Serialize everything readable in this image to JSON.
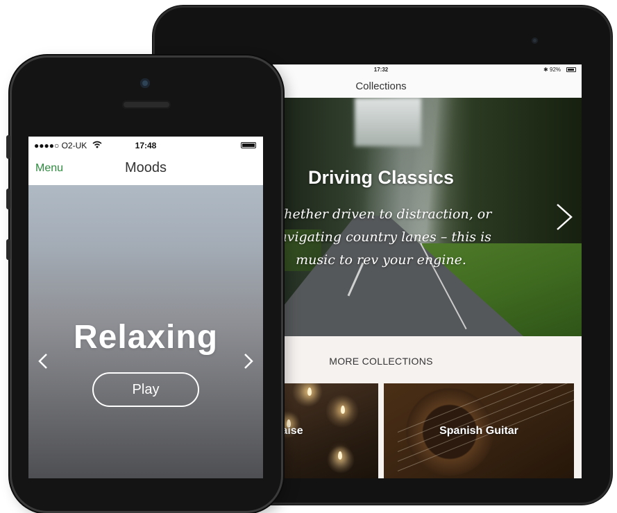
{
  "ipad": {
    "status": {
      "time": "17:32",
      "battery": "92%"
    },
    "nav_title": "Collections",
    "hero": {
      "title": "Driving Classics",
      "description": "Whether driven to distraction, or navigating country lanes – this is music to rev your engine.",
      "next_icon": "chevron-right-icon"
    },
    "more_collections_title": "MORE COLLECTIONS",
    "tiles": [
      {
        "label": "of Praise"
      },
      {
        "label": "Spanish Guitar"
      }
    ]
  },
  "iphone": {
    "status": {
      "carrier": "●●●●○ O2-UK",
      "time": "17:48"
    },
    "nav": {
      "menu_label": "Menu",
      "title": "Moods"
    },
    "mood": {
      "title": "Relaxing",
      "play_label": "Play"
    }
  },
  "colors": {
    "accent_green": "#2e8b3e"
  }
}
